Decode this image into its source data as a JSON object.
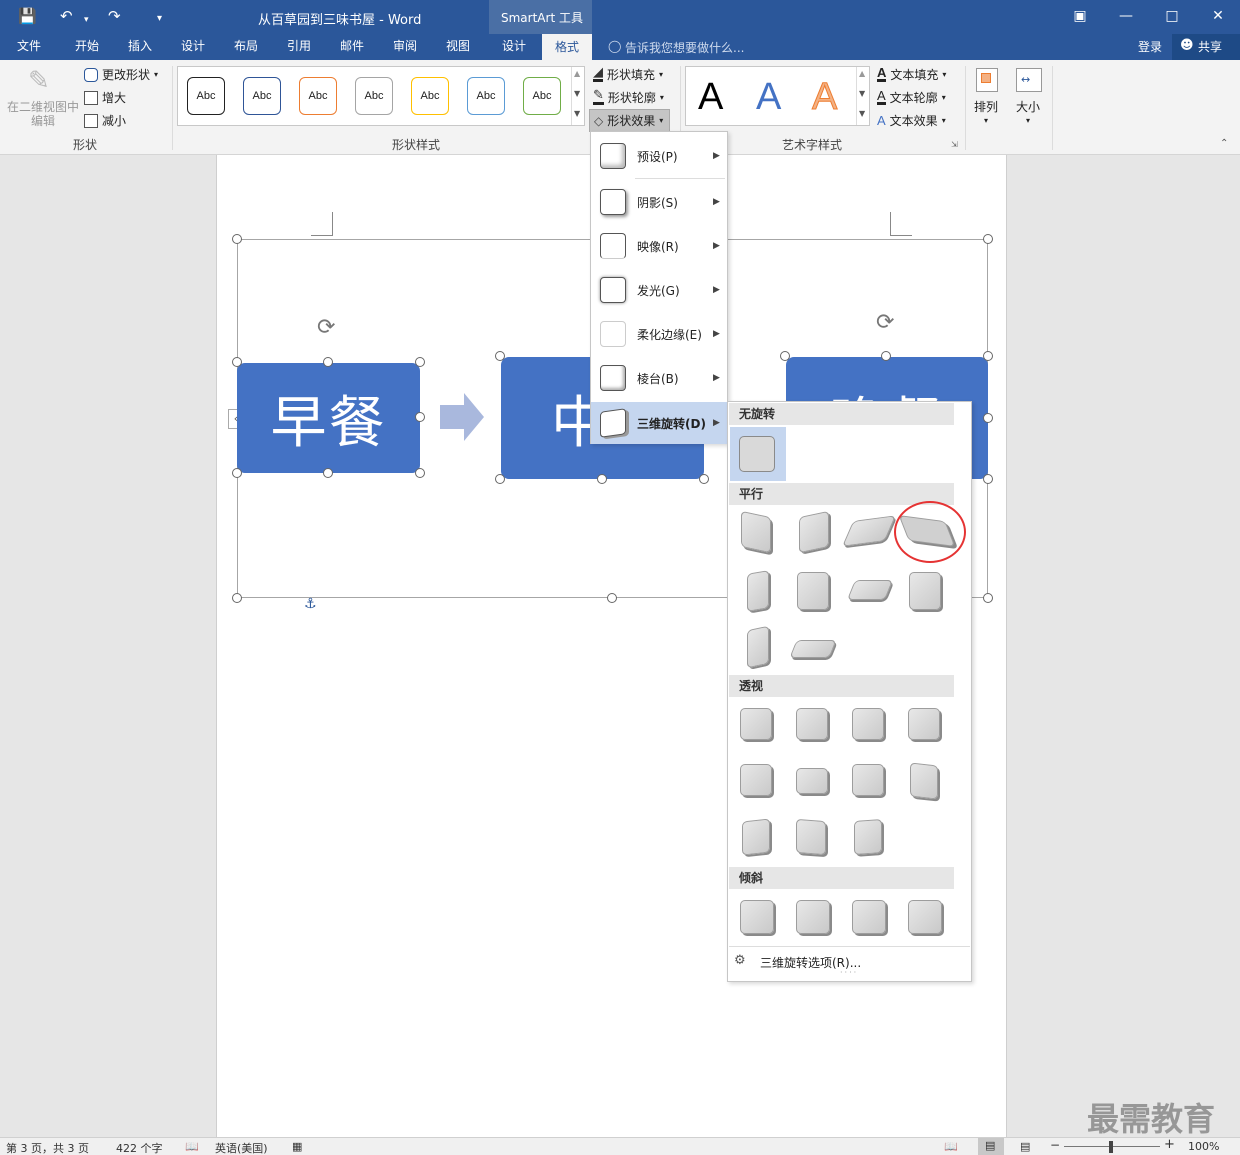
{
  "titlebar": {
    "doc_title": "从百草园到三味书屋 - Word",
    "context_tab": "SmartArt 工具"
  },
  "menu": {
    "tabs": [
      "文件",
      "开始",
      "插入",
      "设计",
      "布局",
      "引用",
      "邮件",
      "审阅",
      "视图",
      "设计",
      "格式"
    ],
    "tell_me": "告诉我您想要做什么...",
    "login": "登录",
    "share": "共享"
  },
  "ribbon": {
    "shape_group": {
      "edit_in_2d": "在二维视图中编辑",
      "change_shape": "更改形状",
      "larger": "增大",
      "smaller": "减小",
      "label": "形状"
    },
    "shape_styles": {
      "abc": "Abc",
      "colors": [
        "#222222",
        "#2f5597",
        "#ed7d31",
        "#a5a5a5",
        "#ffc000",
        "#5b9bd5",
        "#70ad47"
      ],
      "fill": "形状填充",
      "outline": "形状轮廓",
      "effects": "形状效果",
      "label": "形状样式"
    },
    "wordart": {
      "letter": "A",
      "text_fill": "文本填充",
      "text_outline": "文本轮廓",
      "text_effects": "文本效果",
      "label": "艺术字样式"
    },
    "arrange": "排列",
    "size": "大小"
  },
  "smartart": {
    "box1": "早餐",
    "box2": "中",
    "box3": "晚餐"
  },
  "effects_menu": {
    "items": [
      "预设(P)",
      "阴影(S)",
      "映像(R)",
      "发光(G)",
      "柔化边缘(E)",
      "棱台(B)",
      "三维旋转(D)"
    ]
  },
  "rotation_panel": {
    "no_rotation": "无旋转",
    "parallel": "平行",
    "perspective": "透视",
    "oblique": "倾斜",
    "options": "三维旋转选项(R)..."
  },
  "statusbar": {
    "page": "第 3 页，共 3 页",
    "words": "422 个字",
    "language": "英语(美国)",
    "zoom": "100%"
  },
  "watermark": "最需教育"
}
